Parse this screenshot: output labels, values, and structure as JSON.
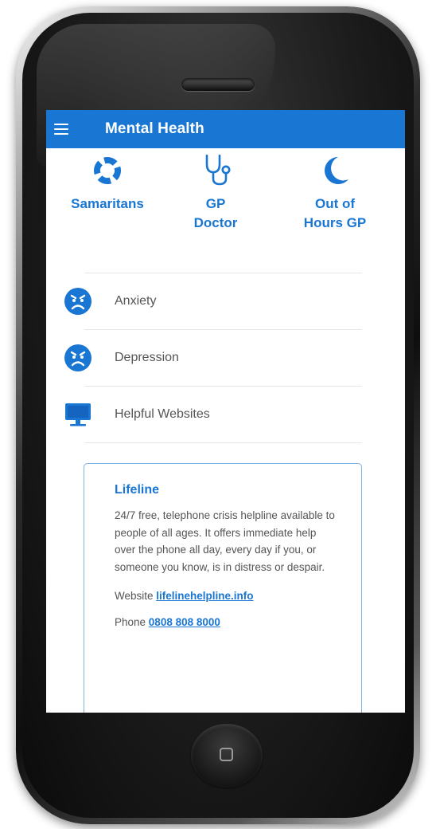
{
  "app": {
    "title": "Mental Health"
  },
  "quick_actions": [
    {
      "label": "Samaritans",
      "icon": "lifebuoy-icon"
    },
    {
      "label": "GP\nDoctor",
      "icon": "stethoscope-icon"
    },
    {
      "label": "Out of\nHours GP",
      "icon": "crescent-moon-icon"
    }
  ],
  "topics": [
    {
      "label": "Anxiety",
      "icon": "sad-face-icon"
    },
    {
      "label": "Depression",
      "icon": "sad-face-icon"
    },
    {
      "label": "Helpful Websites",
      "icon": "monitor-icon"
    }
  ],
  "card": {
    "title": "Lifeline",
    "description": "24/7 free, telephone crisis helpline available to people of all ages. It offers immediate help over the phone all day, every day if you, or someone you know, is in distress or despair.",
    "website_label": "Website",
    "website_link": "lifelinehelpline.info",
    "phone_label": "Phone",
    "phone_link": "0808 808 8000"
  },
  "colors": {
    "primary": "#1976d2",
    "text": "#555555",
    "divider": "#e6e6e6",
    "card_border": "#7fb3e6"
  }
}
